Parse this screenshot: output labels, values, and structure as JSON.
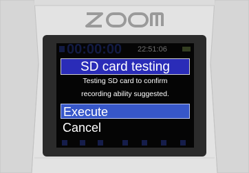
{
  "device": {
    "brand": "ZOOM",
    "colors": {
      "body": "#e3e3e3",
      "bezel": "#2b2b2b",
      "lcd_background": "#050505",
      "dialog_title_bg": "#2a2cb8",
      "selection_bg": "#3757c9",
      "text": "#ffffff"
    }
  },
  "status_bar": {
    "rec_time": "00:00:00",
    "clock": "22:51:06"
  },
  "dialog": {
    "title": "SD card testing",
    "message_line1": "Testing SD card to confirm",
    "message_line2": "recording ability suggested.",
    "options": [
      {
        "label": "Execute",
        "selected": true
      },
      {
        "label": "Cancel",
        "selected": false
      }
    ]
  },
  "icons": [
    "brand-logo",
    "rec-indicator-icon",
    "battery-icon",
    "mic-icon",
    "speaker-icon",
    "folder-icon",
    "usb-icon",
    "settings-icon"
  ]
}
